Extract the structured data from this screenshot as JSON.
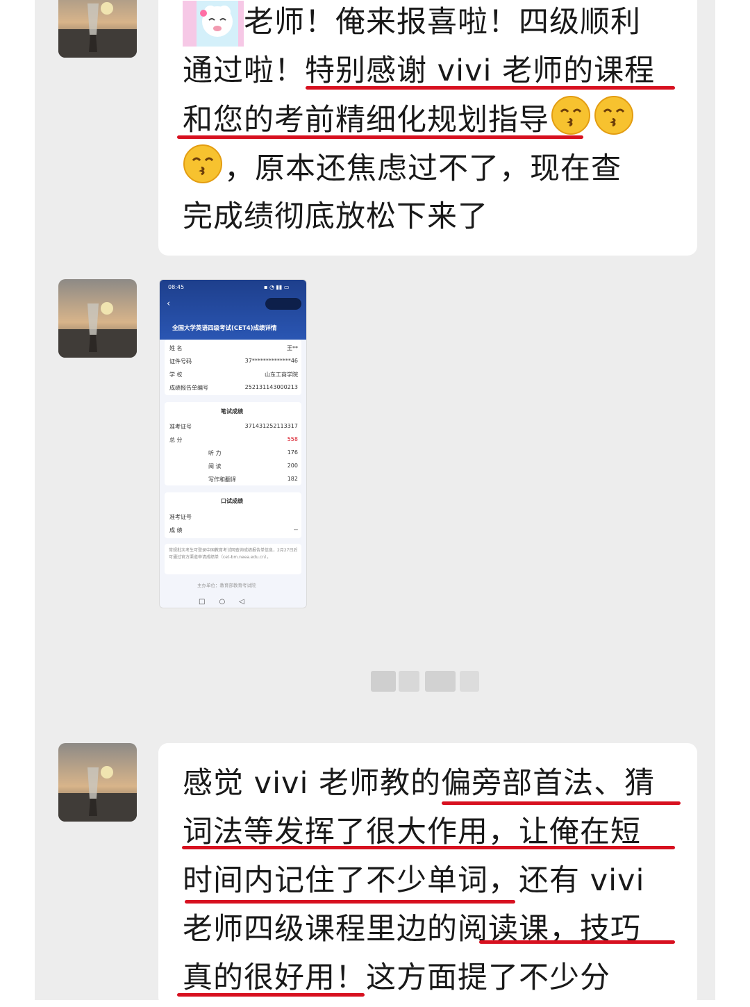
{
  "messages": [
    {
      "lines": [
        "老师！俺来报喜啦！四级顺利",
        "通过啦！特别感谢 vivi 老师的课程",
        "和您的考前精细化规划指导",
        "，原本还焦虑过不了，现在查",
        "完成绩彻底放松下来了"
      ],
      "sticker_icon": "sheep-cartoon-sticker",
      "emoji_icon": "kissing-face-emoji"
    },
    {
      "type": "image",
      "image": {
        "status_time": "08:45",
        "title": "全国大学英语四级考试(CET4)成绩详情",
        "rows": [
          {
            "label": "姓    名",
            "value": "王**"
          },
          {
            "label": "证件号码",
            "value": "37**************46"
          },
          {
            "label": "学    校",
            "value": "山东工商学院"
          },
          {
            "label": "成绩报告单编号",
            "value": "252131143000213"
          }
        ],
        "written_title": "笔试成绩",
        "written_rows": [
          {
            "label": "准考证号",
            "value": "371431252113317"
          },
          {
            "label": "总    分",
            "value": "558"
          },
          {
            "label": "听    力",
            "value": "176"
          },
          {
            "label": "阅    读",
            "value": "200"
          },
          {
            "label": "写作和翻译",
            "value": "182"
          }
        ],
        "oral_title": "口试成绩",
        "oral_rows": [
          {
            "label": "准考证号",
            "value": ""
          },
          {
            "label": "成    绩",
            "value": "--"
          }
        ],
        "note": "常规批次考生可登录中国教育考试网查询成绩报告单信息，2月27日后可通过官方渠道申请成绩单（cet-bm.neea.edu.cn）。",
        "footer": "主办单位：教育部教育考试院"
      }
    },
    {
      "lines": [
        "感觉 vivi 老师教的偏旁部首法、猜",
        "词法等发挥了很大作用，让俺在短",
        "时间内记住了不少单词，还有 vivi",
        "老师四级课程里边的阅读课，技巧",
        "真的很好用！这方面提了不少分"
      ]
    }
  ],
  "colors": {
    "background": "#ededed",
    "bubble": "#ffffff",
    "underline": "#d7101f",
    "text": "#191919"
  }
}
